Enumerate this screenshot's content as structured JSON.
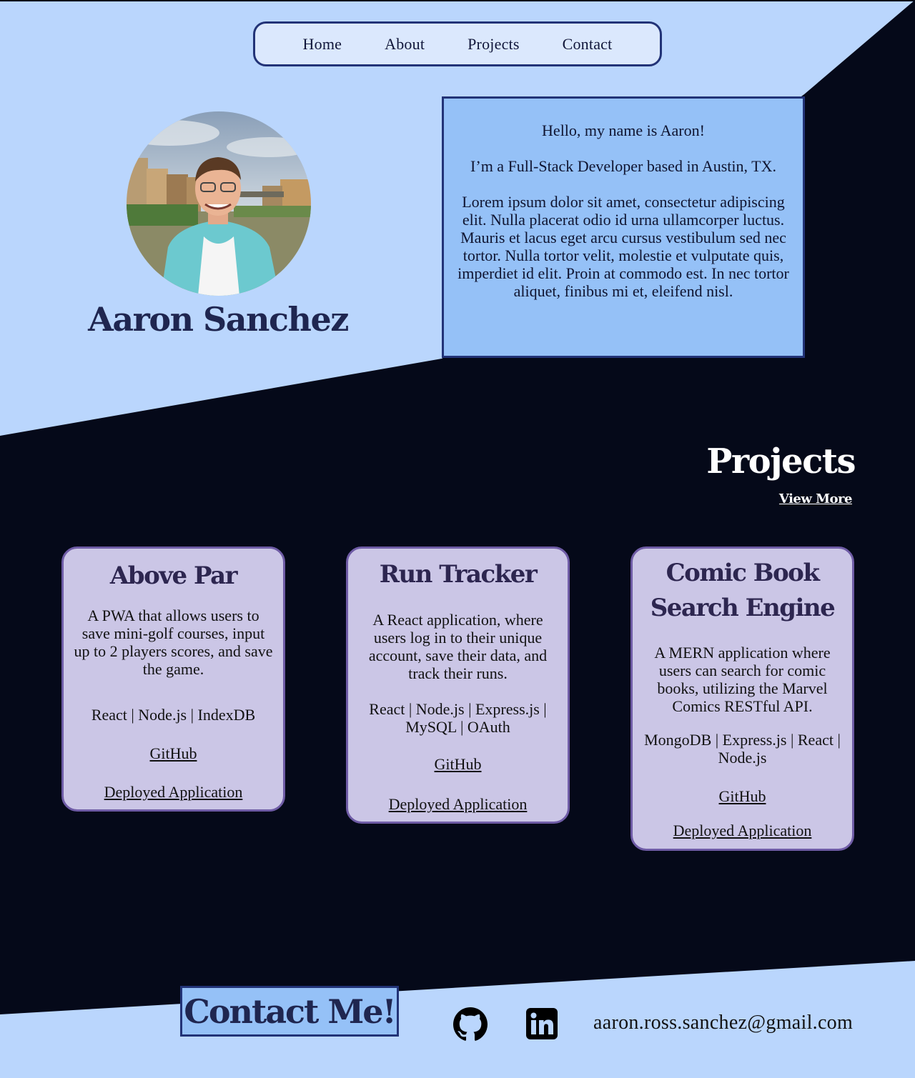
{
  "nav": {
    "items": [
      {
        "label": "Home"
      },
      {
        "label": "About"
      },
      {
        "label": "Projects"
      },
      {
        "label": "Contact"
      }
    ]
  },
  "hero": {
    "name": "Aaron Sanchez",
    "greeting": "Hello, my name is Aaron!",
    "role": "I’m a Full-Stack Developer based in Austin, TX.",
    "lorem": "Lorem ipsum dolor sit amet, consectetur adipiscing elit. Nulla placerat odio id urna ullamcorper luctus. Mauris et lacus eget arcu cursus vestibulum sed nec tortor. Nulla tortor velit, molestie et vulputate quis, imperdiet id elit. Proin at commodo est. In nec tortor aliquet, finibus mi et, eleifend nisl."
  },
  "projects": {
    "title": "Projects",
    "view_more": "View More",
    "cards": [
      {
        "title": "Above Par",
        "description": "A PWA that allows users to save mini-golf courses, input up to 2 players scores, and save the game.",
        "tech": "React | Node.js | IndexDB",
        "github_label": "GitHub",
        "deployed_label": "Deployed Application"
      },
      {
        "title": "Run Tracker",
        "description": "A React application, where users log in to their unique account, save their data, and track their runs.",
        "tech": "React | Node.js | Express.js | MySQL | OAuth",
        "github_label": "GitHub",
        "deployed_label": "Deployed Application"
      },
      {
        "title": "Comic Book Search Engine",
        "description": "A MERN application where users can search for comic books, utilizing the Marvel Comics RESTful API.",
        "tech": "MongoDB | Express.js | React | Node.js",
        "github_label": "GitHub",
        "deployed_label": "Deployed Application"
      }
    ]
  },
  "footer": {
    "contact_label": "Contact Me!",
    "email": "aaron.ross.sanchez@gmail.com",
    "icons": [
      "github-icon",
      "linkedin-icon"
    ]
  },
  "colors": {
    "light_bg": "#bad6fd",
    "dark_bg": "#050919",
    "accent_box": "#95c1f7",
    "card_bg": "#cbc6e6",
    "card_border": "#6f5ca6",
    "navy": "#223377"
  }
}
